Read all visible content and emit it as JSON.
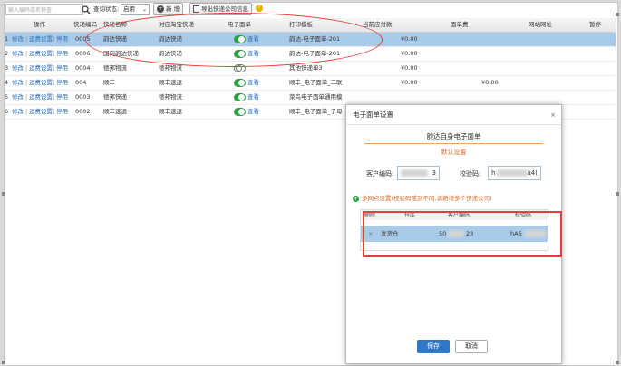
{
  "toolbar": {
    "search_placeholder": "输入编码或名称查",
    "status_label": "查询状态:",
    "status_value": "启用",
    "add_label": "新 增",
    "export_label": "导出快递公司信息"
  },
  "table": {
    "columns": [
      "操作",
      "快递编码",
      "快递名称",
      "对应淘宝快递",
      "电子面单",
      "打印模板",
      "当前应付款",
      "面单费",
      "网站网址",
      "暂停"
    ],
    "rows": [
      {
        "index": "1",
        "actions": [
          "修改",
          "运费设置",
          "停用"
        ],
        "code": "0005",
        "name": "韵达快递",
        "taobao": "韵达快递",
        "eform_on": true,
        "view": "查看",
        "template": "韵达-电子面单-201",
        "payable": "¥0.00",
        "fee": ""
      },
      {
        "index": "2",
        "actions": [
          "修改",
          "运费设置",
          "停用"
        ],
        "code": "0006",
        "name": "国内韵达快递",
        "taobao": "韵达快递",
        "eform_on": true,
        "view": "查看",
        "template": "韵达-电子面单-201",
        "payable": "¥0.00",
        "fee": ""
      },
      {
        "index": "3",
        "actions": [
          "修改",
          "运费设置",
          "停用"
        ],
        "code": "0004",
        "name": "德邦物流",
        "taobao": "德邦物流",
        "eform_on": false,
        "view": "",
        "template": "其他快递单3",
        "payable": "¥0.00",
        "fee": ""
      },
      {
        "index": "4",
        "actions": [
          "修改",
          "运费设置",
          "停用"
        ],
        "code": "004",
        "name": "顺丰",
        "taobao": "顺丰速运",
        "eform_on": true,
        "view": "查看",
        "template": "顺丰_电子面单_二联",
        "payable": "¥0.00",
        "fee": "¥0.00"
      },
      {
        "index": "5",
        "actions": [
          "修改",
          "运费设置",
          "停用"
        ],
        "code": "0003",
        "name": "德邦快递",
        "taobao": "德邦物流",
        "eform_on": true,
        "view": "查看",
        "template": "菜鸟电子面单通用模",
        "payable": "¥0.00",
        "fee": ""
      },
      {
        "index": "6",
        "actions": [
          "修改",
          "运费设置",
          "停用"
        ],
        "code": "0002",
        "name": "顺丰速运",
        "taobao": "顺丰速运",
        "eform_on": true,
        "view": "查看",
        "template": "顺丰_电子面单_子母",
        "payable": "¥0.00",
        "fee": ""
      }
    ]
  },
  "dialog": {
    "title": "电子面单设置",
    "close": "×",
    "heading": "韵达自身电子面单",
    "default_label": "默认设置",
    "customer_code_label": "客户编码:",
    "customer_code_value": "3",
    "check_code_label": "校验码:",
    "check_code_prefix": "h",
    "check_code_suffix": "a4(",
    "multi_hint": "多网点设置(校验码或到不同,请新增多个快递公司)",
    "sub_columns": [
      "删除",
      "仓库",
      "客户编码",
      "校验码"
    ],
    "sub_row": {
      "delete": "×",
      "warehouse": "发货仓",
      "code_prefix": "50",
      "code_suffix": "23",
      "check": "hA6"
    },
    "save_label": "保存",
    "cancel_label": "取消"
  },
  "colors": {
    "accent": "#2f77c9",
    "selected_row": "#a9cbe8",
    "annotation_red": "#e0413a",
    "toggle_on": "#2ba245"
  }
}
